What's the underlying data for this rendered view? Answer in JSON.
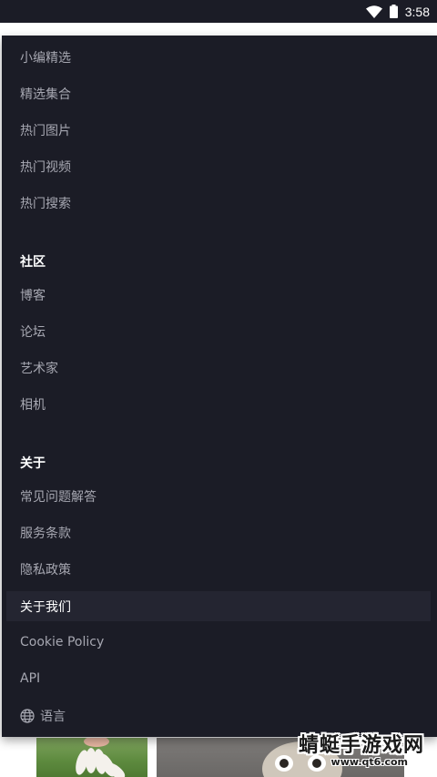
{
  "status_bar": {
    "time": "3:58",
    "icons": [
      "wifi-icon",
      "battery-icon"
    ]
  },
  "menu": {
    "discover_items": [
      {
        "label": "小编精选"
      },
      {
        "label": "精选集合"
      },
      {
        "label": "热门图片"
      },
      {
        "label": "热门视频"
      },
      {
        "label": "热门搜索"
      }
    ],
    "community": {
      "header": "社区",
      "items": [
        {
          "label": "博客"
        },
        {
          "label": "论坛"
        },
        {
          "label": "艺术家"
        },
        {
          "label": "相机"
        }
      ]
    },
    "about": {
      "header": "关于",
      "items": [
        {
          "label": "常见问题解答"
        },
        {
          "label": "服务条款"
        },
        {
          "label": "隐私政策"
        },
        {
          "label": "关于我们"
        },
        {
          "label": "Cookie Policy"
        },
        {
          "label": "API"
        }
      ]
    },
    "language": {
      "label": "语言",
      "icon": "globe-icon"
    }
  },
  "watermark": {
    "title": "蜻蜓手游戏网",
    "url": "www.qt6.com"
  },
  "colors": {
    "panel_bg": "#1b1c26",
    "item_text": "#a6a7b1",
    "header_text": "#ffffff",
    "highlight_bg": "#242531"
  }
}
